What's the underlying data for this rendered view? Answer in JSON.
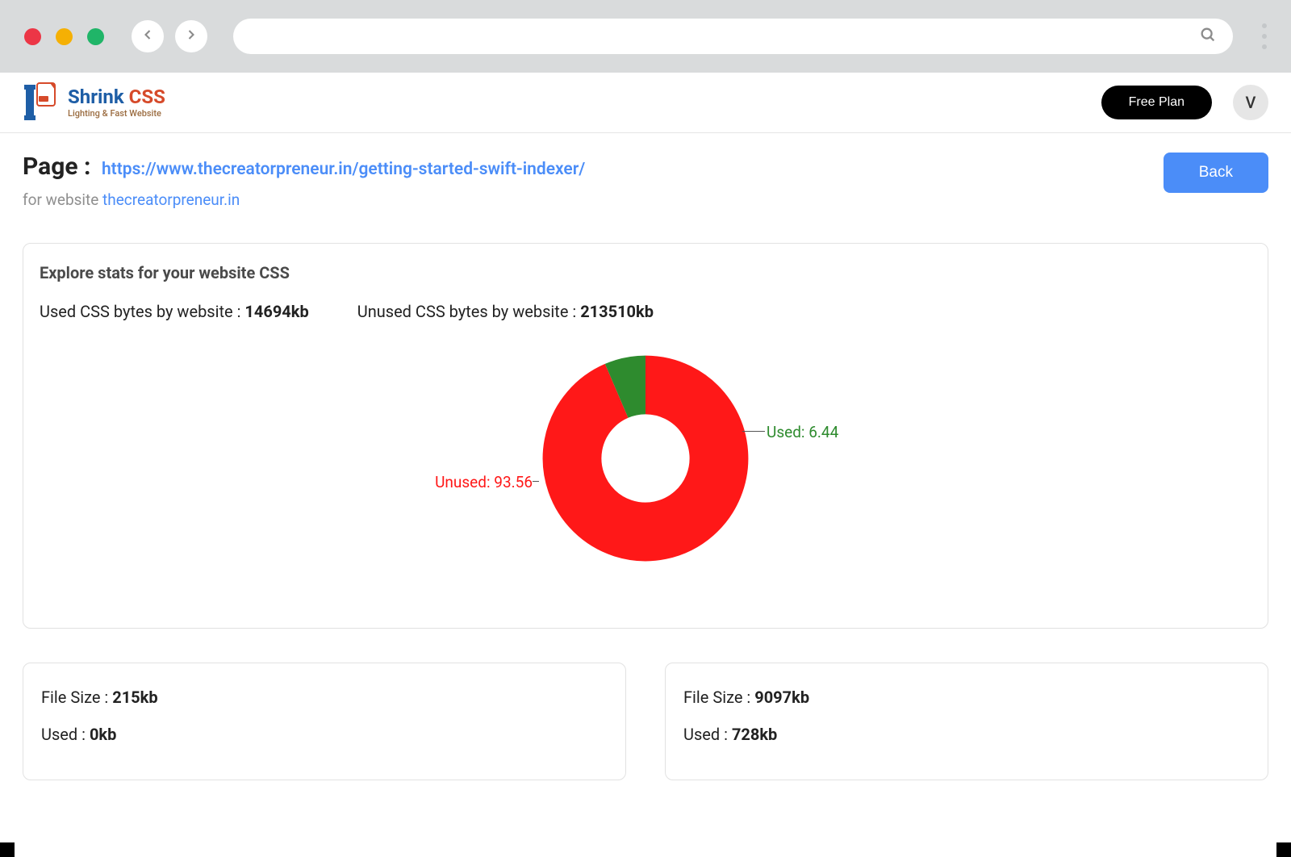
{
  "browser": {
    "url": ""
  },
  "brand": {
    "name_part1": "Shrink ",
    "name_part2": "CSS",
    "tagline": "Lighting & Fast Website"
  },
  "header": {
    "plan_label": "Free Plan",
    "avatar_initial": "V"
  },
  "page": {
    "title_prefix": "Page : ",
    "url": "https://www.thecreatorpreneur.in/getting-started-swift-indexer/",
    "subtitle_prefix": "for website ",
    "website": "thecreatorpreneur.in",
    "back_label": "Back"
  },
  "stats": {
    "card_title": "Explore stats for your website CSS",
    "used_label": "Used CSS bytes by website : ",
    "used_value": "14694kb",
    "unused_label": "Unused CSS bytes by website : ",
    "unused_value": "213510kb"
  },
  "chart_data": {
    "type": "pie",
    "title": "",
    "series": [
      {
        "name": "Unused",
        "value": 93.56,
        "color": "#ff1818",
        "label": "Unused: 93.56"
      },
      {
        "name": "Used",
        "value": 6.44,
        "color": "#2e8b2e",
        "label": "Used: 6.44"
      }
    ]
  },
  "file_cards": [
    {
      "file_size_label": "File Size : ",
      "file_size_value": "215kb",
      "used_label": "Used : ",
      "used_value": "0kb"
    },
    {
      "file_size_label": "File Size : ",
      "file_size_value": "9097kb",
      "used_label": "Used : ",
      "used_value": "728kb"
    }
  ]
}
